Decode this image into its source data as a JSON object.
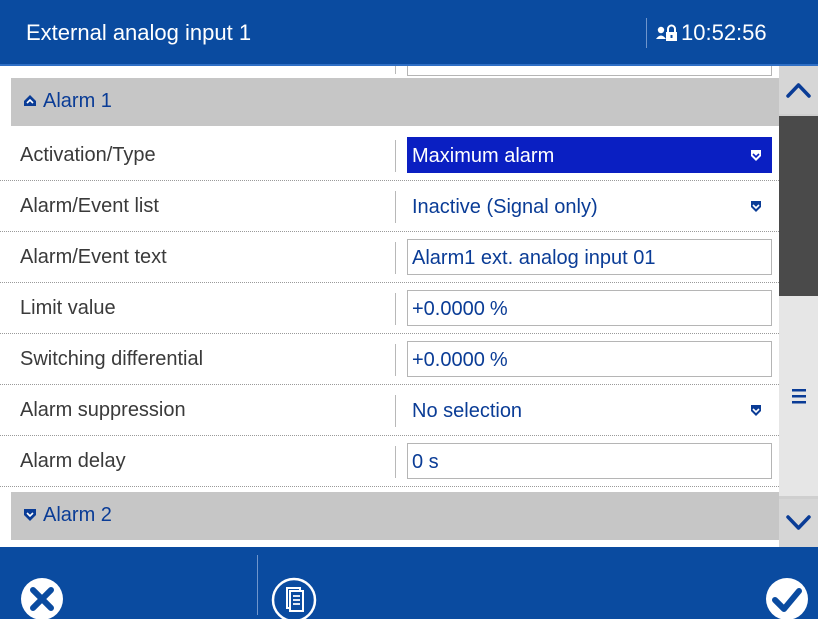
{
  "header": {
    "title": "External analog input 1",
    "time": "10:52:56",
    "lock_icon": "user-lock-icon"
  },
  "sections": {
    "alarm1_title": "Alarm 1",
    "alarm1_icon": "chevron-up-icon",
    "alarm2_title": "Alarm 2",
    "alarm2_icon": "chevron-down-icon"
  },
  "rows": [
    {
      "label": "Activation/Type",
      "value": "Maximum alarm",
      "kind": "dropdown",
      "selected": true
    },
    {
      "label": "Alarm/Event list",
      "value": "Inactive (Signal only)",
      "kind": "dropdown"
    },
    {
      "label": "Alarm/Event text",
      "value": "Alarm1 ext. analog input 01",
      "kind": "text"
    },
    {
      "label": "Limit value",
      "value": "+0.0000",
      "unit": "%",
      "kind": "number"
    },
    {
      "label": "Switching differential",
      "value": "+0.0000",
      "unit": "%",
      "kind": "number"
    },
    {
      "label": "Alarm suppression",
      "value": "No selection",
      "kind": "dropdown"
    },
    {
      "label": "Alarm delay",
      "value": "0 s",
      "kind": "text"
    }
  ],
  "scrollbar": {
    "up_icon": "chevron-up-icon",
    "menu_icon": "menu-icon",
    "down_icon": "chevron-down-icon"
  },
  "footer": {
    "cancel_icon": "cancel-icon",
    "document_icon": "document-list-icon",
    "confirm_icon": "checkmark-icon"
  },
  "colors": {
    "header_bg": "#0a4ba0",
    "selected_bg": "#0a1fc2",
    "value_text": "#0a3c96",
    "section_bg": "#c6c6c6"
  }
}
